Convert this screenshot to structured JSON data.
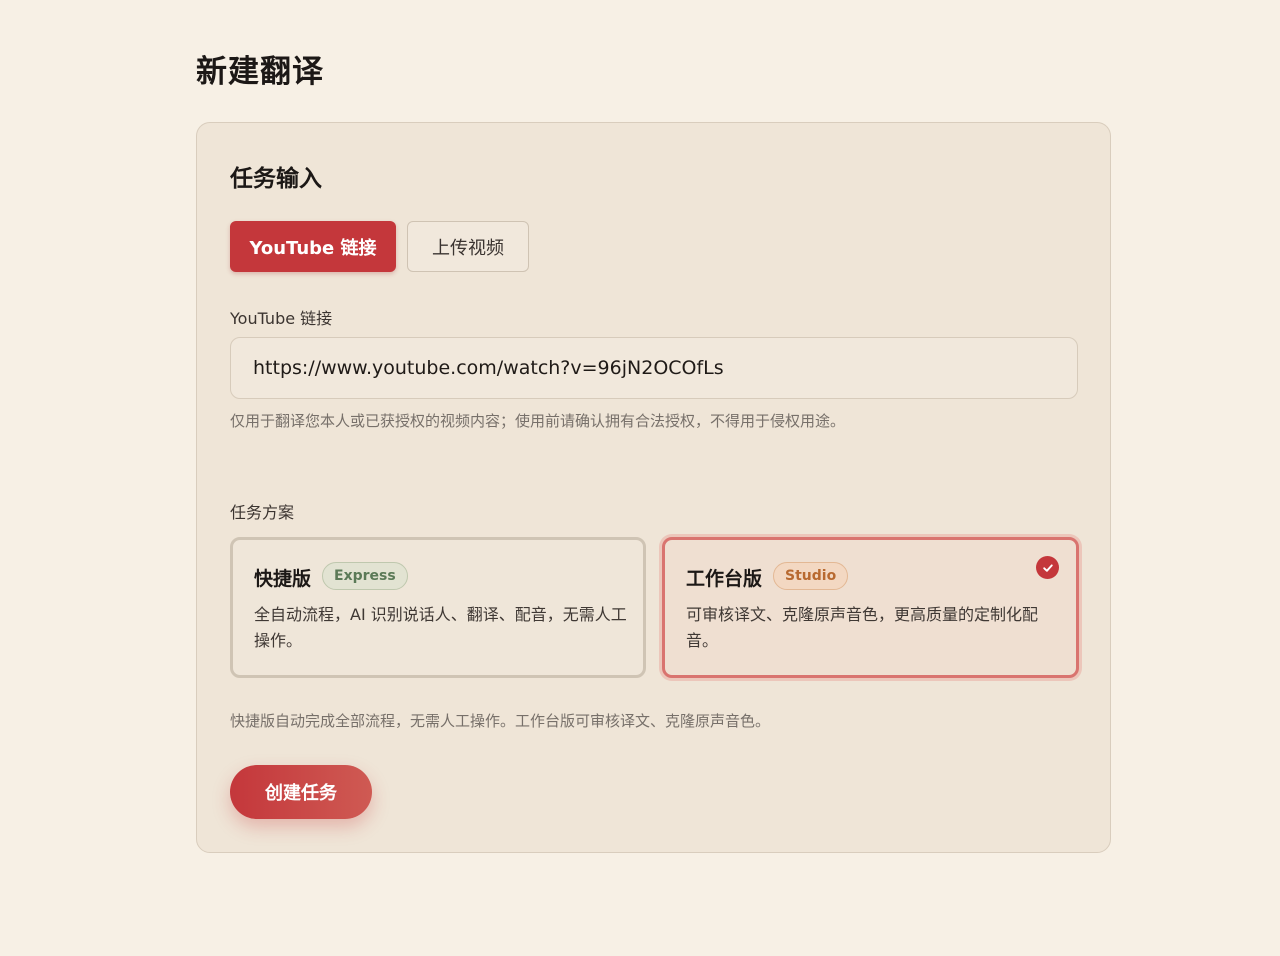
{
  "page": {
    "title": "新建翻译"
  },
  "task_input": {
    "section_title": "任务输入",
    "tabs": [
      {
        "label": "YouTube 链接",
        "active": true
      },
      {
        "label": "上传视频",
        "active": false
      }
    ],
    "youtube_field": {
      "label": "YouTube 链接",
      "value": "https://www.youtube.com/watch?v=96jN2OCOfLs",
      "hint": "仅用于翻译您本人或已获授权的视频内容；使用前请确认拥有合法授权，不得用于侵权用途。"
    }
  },
  "task_plan": {
    "label": "任务方案",
    "options": [
      {
        "name": "快捷版",
        "badge": "Express",
        "description": "全自动流程，AI 识别说话人、翻译、配音，无需人工操作。",
        "selected": false
      },
      {
        "name": "工作台版",
        "badge": "Studio",
        "description": "可审核译文、克隆原声音色，更高质量的定制化配音。",
        "selected": true,
        "selected_icon": "check-icon"
      }
    ],
    "hint": "快捷版自动完成全部流程，无需人工操作。工作台版可审核译文、克隆原声音色。"
  },
  "actions": {
    "create_label": "创建任务"
  },
  "colors": {
    "accent": "#c4373b",
    "background": "#f7f0e5",
    "card": "#efe5d7",
    "express_badge": "#5b7a57",
    "studio_badge": "#b8692f"
  }
}
